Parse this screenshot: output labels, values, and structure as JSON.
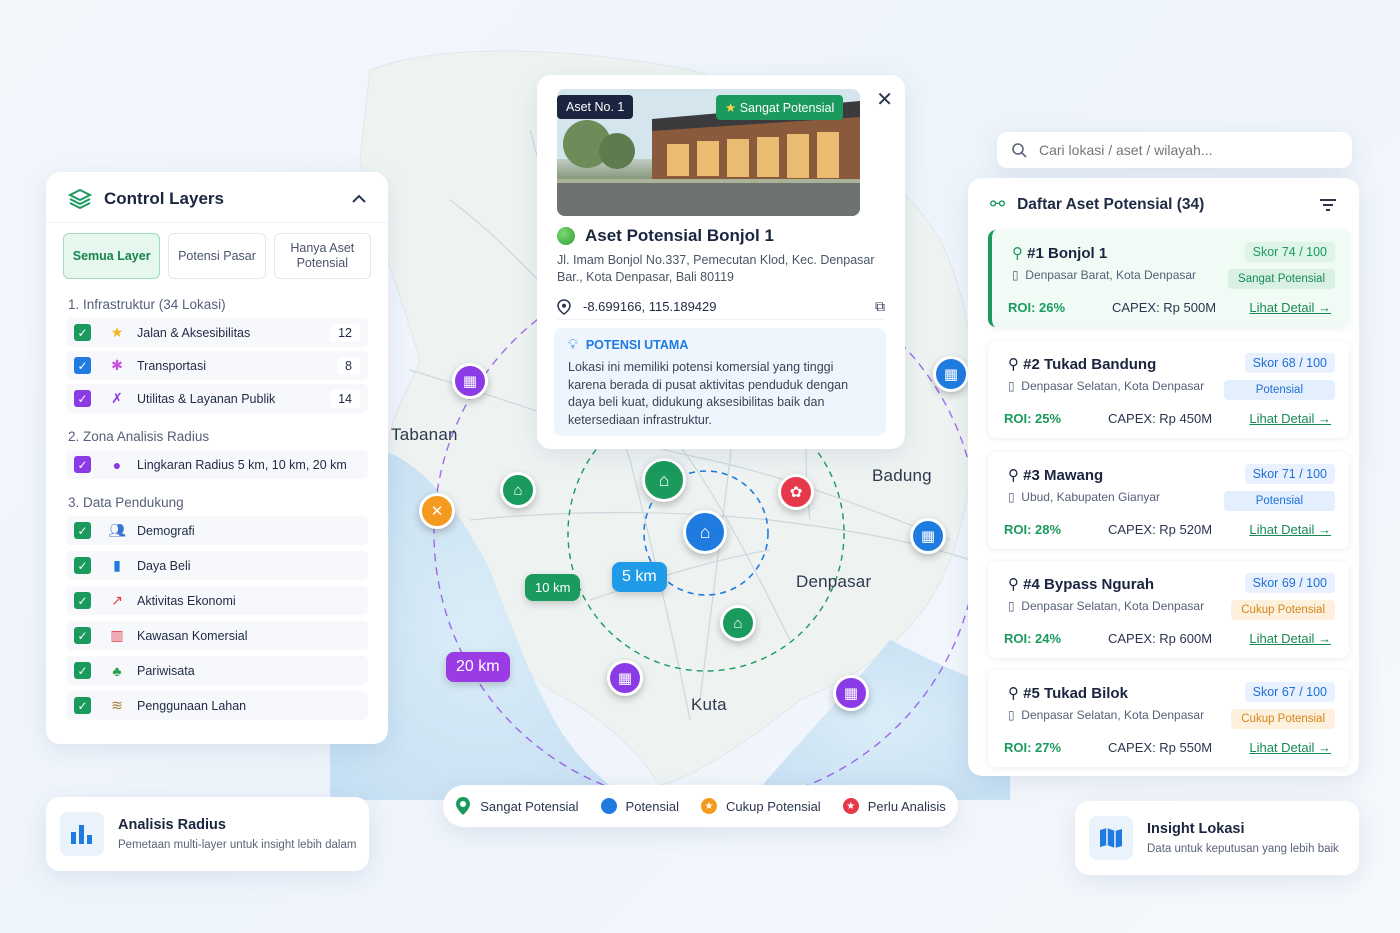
{
  "map": {
    "labels": {
      "tabanan": "Tabanan",
      "badung": "Badung",
      "denpasar": "Denpasar",
      "kuta": "Kuta"
    },
    "radius": {
      "r5": "5 km",
      "r10": "10 km",
      "r20": "20 km"
    }
  },
  "control": {
    "title": "Control Layers",
    "tabs": [
      "Semua Layer",
      "Potensi Pasar",
      "Hanya Aset Potensial"
    ],
    "sections": [
      {
        "title": "1. Infrastruktur (34 Lokasi)",
        "items": [
          {
            "label": "Jalan & Aksesibilitas",
            "count": "12",
            "icon": "star-icon"
          },
          {
            "label": "Transportasi",
            "count": "8",
            "icon": "transport-icon"
          },
          {
            "label": "Utilitas & Layanan Publik",
            "count": "14",
            "icon": "utility-icon"
          }
        ]
      },
      {
        "title": "2. Zona Analisis Radius",
        "items": [
          {
            "label": "Lingkaran Radius 5 km, 10 km, 20 km",
            "icon": "circle-icon"
          }
        ]
      },
      {
        "title": "3. Data Pendukung",
        "items": [
          {
            "label": "Demografi",
            "icon": "people-icon"
          },
          {
            "label": "Daya Beli",
            "icon": "bar-chart-icon"
          },
          {
            "label": "Aktivitas Ekonomi",
            "icon": "line-chart-icon"
          },
          {
            "label": "Kawasan Komersial",
            "icon": "store-icon"
          },
          {
            "label": "Pariwisata",
            "icon": "palm-icon"
          },
          {
            "label": "Penggunaan Lahan",
            "icon": "layers-icon"
          }
        ]
      }
    ]
  },
  "popup": {
    "asset_no": "Aset No. 1",
    "status": "Sangat Potensial",
    "title": "Aset Potensial Bonjol 1",
    "address": "Jl. Imam Bonjol No.337, Pemecutan Klod, Kec. Denpasar Bar., Kota Denpasar, Bali 80119",
    "coords": "-8.699166, 115.189429",
    "potensi_title": "POTENSI UTAMA",
    "potensi_text": "Lokasi ini memiliki potensi komersial yang tinggi karena berada di pusat aktivitas penduduk dengan daya beli kuat, didukung aksesibilitas baik dan ketersediaan infrastruktur."
  },
  "search": {
    "placeholder": "Cari lokasi / aset / wilayah..."
  },
  "list": {
    "title": "Daftar Aset Potensial (34)",
    "assets": [
      {
        "name": "#1 Bonjol 1",
        "location": "Denpasar Barat, Kota Denpasar",
        "score": "Skor 74 / 100",
        "badge": "Sangat Potensial",
        "roi": "ROI: 26%",
        "capex": "CAPEX: Rp 500M",
        "detail": "Lihat Detail →"
      },
      {
        "name": "#2 Tukad Bandung",
        "location": "Denpasar Selatan, Kota Denpasar",
        "score": "Skor 68 / 100",
        "badge": "Potensial",
        "roi": "ROI: 25%",
        "capex": "CAPEX: Rp 450M",
        "detail": "Lihat Detail →"
      },
      {
        "name": "#3 Mawang",
        "location": "Ubud, Kabupaten Gianyar",
        "score": "Skor 71 / 100",
        "badge": "Potensial",
        "roi": "ROI: 28%",
        "capex": "CAPEX: Rp 520M",
        "detail": "Lihat Detail →"
      },
      {
        "name": "#4 Bypass Ngurah",
        "location": "Denpasar Selatan, Kota Denpasar",
        "score": "Skor 69 / 100",
        "badge": "Cukup Potensial",
        "roi": "ROI: 24%",
        "capex": "CAPEX: Rp 600M",
        "detail": "Lihat Detail →"
      },
      {
        "name": "#5 Tukad Bilok",
        "location": "Denpasar Selatan, Kota Denpasar",
        "score": "Skor 67 / 100",
        "badge": "Cukup Potensial",
        "roi": "ROI: 27%",
        "capex": "CAPEX: Rp 550M",
        "detail": "Lihat Detail →"
      }
    ]
  },
  "legend": {
    "items": [
      {
        "label": "Sangat Potensial",
        "color": "#1a9a5c"
      },
      {
        "label": "Potensial",
        "color": "#1f7be0"
      },
      {
        "label": "Cukup Potensial",
        "color": "#f39a1f"
      },
      {
        "label": "Perlu Analisis",
        "color": "#e5384a"
      }
    ]
  },
  "analisis": {
    "title": "Analisis Radius",
    "subtitle": "Pemetaan multi-layer untuk insight lebih dalam"
  },
  "insight": {
    "title": "Insight Lokasi",
    "subtitle": "Data untuk keputusan yang lebih baik"
  },
  "colors": {
    "green": "#1a9a5c",
    "blue": "#1f7be0",
    "purple": "#8a3be6",
    "orange": "#f39a1f",
    "red": "#e5384a"
  }
}
